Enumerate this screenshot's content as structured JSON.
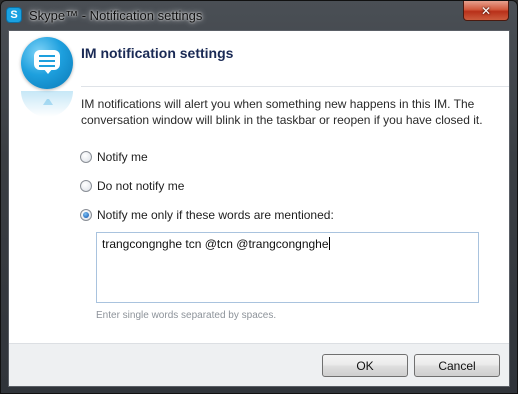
{
  "window": {
    "title": "Skype™ - Notification settings",
    "app_icon_letter": "S",
    "close_glyph": "✕"
  },
  "dialog": {
    "heading": "IM notification settings",
    "description": "IM notifications will alert you when something new happens in this IM. The conversation window will blink in the taskbar or reopen if you have closed it.",
    "options": [
      {
        "label": "Notify me",
        "checked": false
      },
      {
        "label": "Do not notify me",
        "checked": false
      },
      {
        "label": "Notify me only if these words are mentioned:",
        "checked": true
      }
    ],
    "keywords_value": "trangcongnghe tcn @tcn @trangcongnghe",
    "keywords_hint": "Enter single words separated by spaces."
  },
  "footer": {
    "ok_label": "OK",
    "cancel_label": "Cancel"
  },
  "icons": {
    "app": "skype-icon",
    "header": "chat-bubble-icon",
    "close": "close-icon"
  }
}
